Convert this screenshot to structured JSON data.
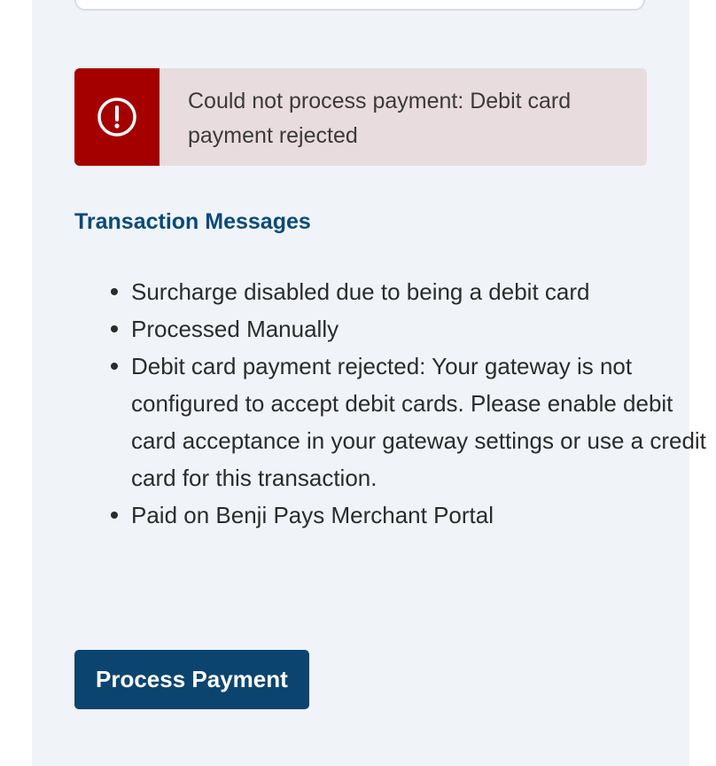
{
  "alert": {
    "icon": "exclamation-circle-icon",
    "message": "Could not process payment: Debit card payment rejected",
    "color": "#a50000",
    "background": "#e9dcdf"
  },
  "transaction_messages": {
    "heading": "Transaction Messages",
    "items": [
      "Surcharge disabled due to being a debit card",
      "Processed Manually",
      "Debit card payment rejected: Your gateway is not configured to accept debit cards. Please enable debit card acceptance in your gateway settings or use a credit card for this transaction.",
      "Paid on Benji Pays Merchant Portal"
    ]
  },
  "actions": {
    "process_payment_label": "Process Payment",
    "button_color": "#0b456f"
  }
}
